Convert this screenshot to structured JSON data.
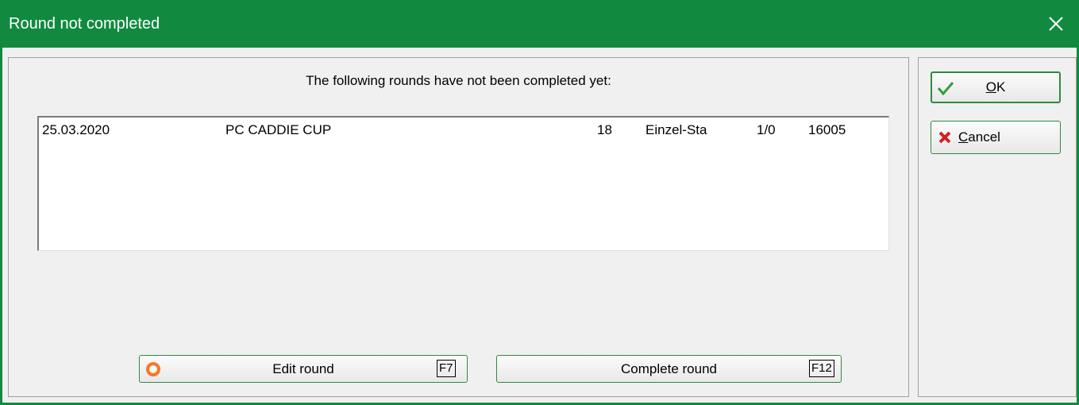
{
  "window": {
    "title": "Round not completed",
    "close_glyph": "✕"
  },
  "message": "The following rounds have not been completed yet:",
  "rounds": [
    {
      "date": "25.03.2020",
      "name": "PC CADDIE CUP",
      "holes": "18",
      "mode": "Einzel-Sta",
      "ratio": "1/0",
      "id": "16005"
    }
  ],
  "buttons": {
    "ok": {
      "label_prefix": "",
      "label_mnemonic": "O",
      "label_rest": "K"
    },
    "cancel": {
      "label_mnemonic": "C",
      "label_rest": "ancel"
    },
    "edit_round": {
      "label": "Edit round",
      "key": "F7"
    },
    "complete_round": {
      "label": "Complete round",
      "key": "F12"
    }
  },
  "colors": {
    "titlebar": "#118a3f",
    "ok_check": "#2e9e3a",
    "cancel_x": "#d42020",
    "edit_icon": "#f07a2a"
  },
  "icons": {
    "ok": "check-icon",
    "cancel": "x-icon",
    "edit": "circle-target-icon",
    "close": "close-icon"
  }
}
